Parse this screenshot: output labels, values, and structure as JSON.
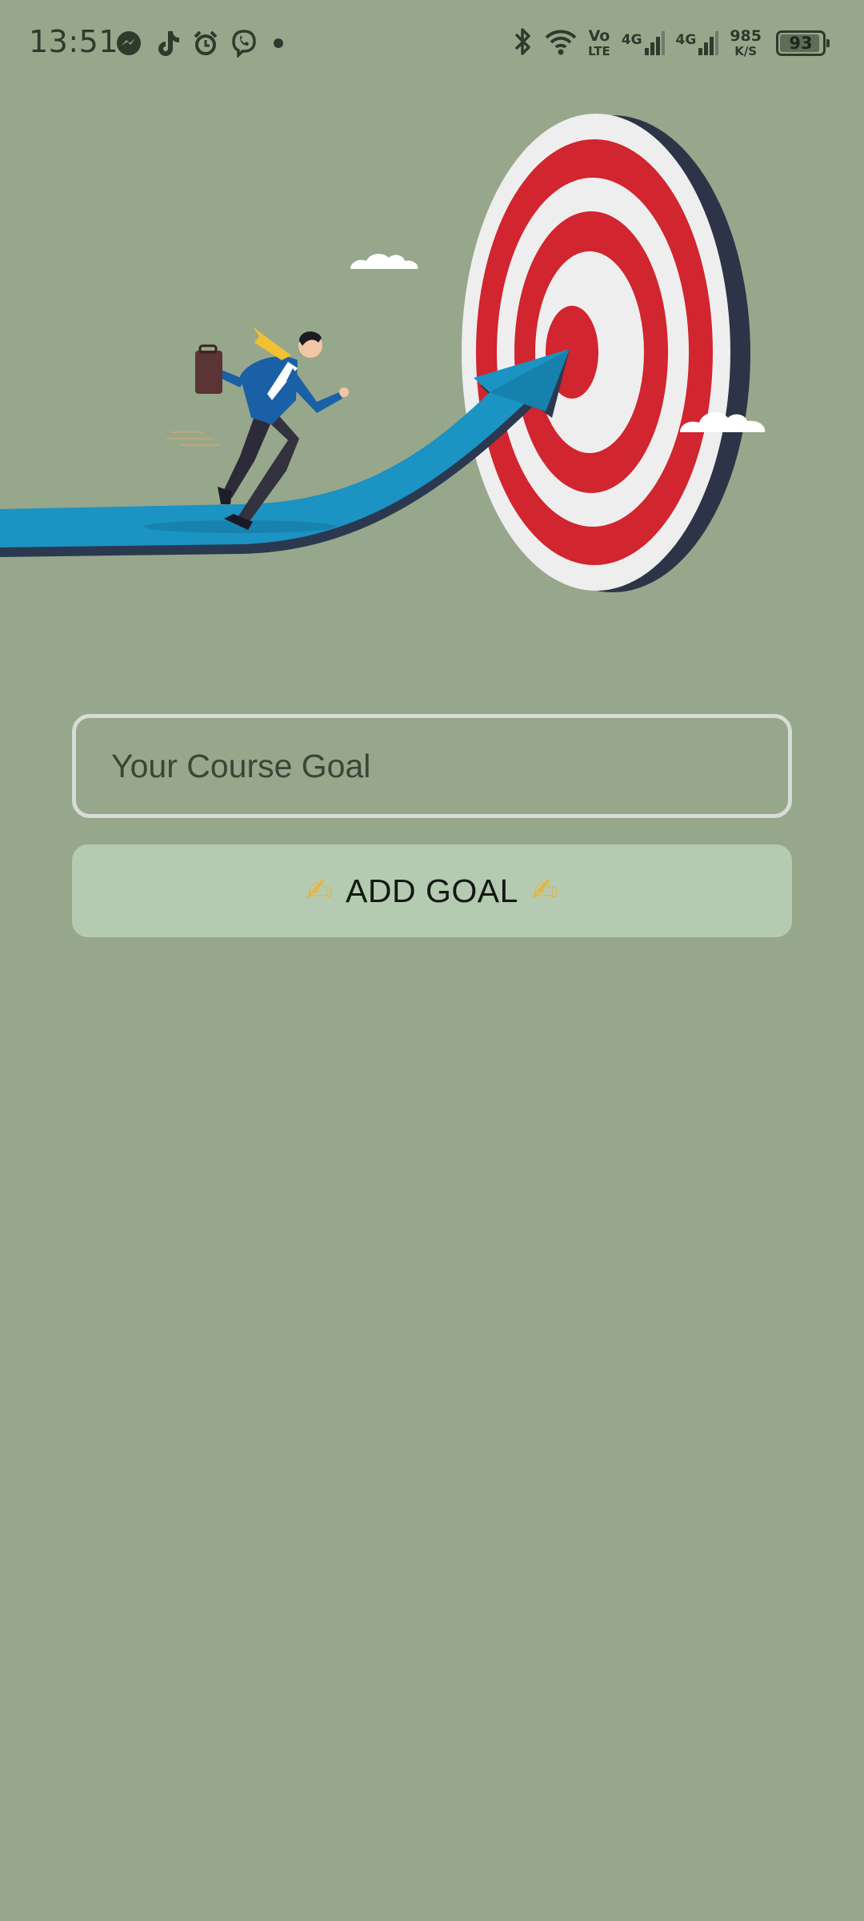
{
  "status_bar": {
    "time": "13:51",
    "left_icons": [
      "messenger-icon",
      "tiktok-icon",
      "alarm-icon",
      "viber-icon",
      "dot-icon"
    ],
    "volte_top": "Vo",
    "volte_bottom": "LTE",
    "network_1": "4G",
    "network_2": "4G",
    "speed_value": "985",
    "speed_unit": "K/S",
    "battery_level": "93"
  },
  "illustration": {
    "subject": "businessman running on arrow toward target",
    "icons": [
      "target-icon",
      "arrow-icon",
      "runner-icon",
      "briefcase-icon",
      "cloud-icon"
    ]
  },
  "form": {
    "input_placeholder": "Your Course Goal",
    "input_value": "",
    "add_button_label": "ADD GOAL",
    "add_button_icon": "writing-hand-icon"
  },
  "colors": {
    "background": "#97a78b",
    "button_bg": "#b5cbb1",
    "input_border": "#d9dcd6",
    "target_red": "#d1252f",
    "arrow_blue": "#1b93c3"
  }
}
